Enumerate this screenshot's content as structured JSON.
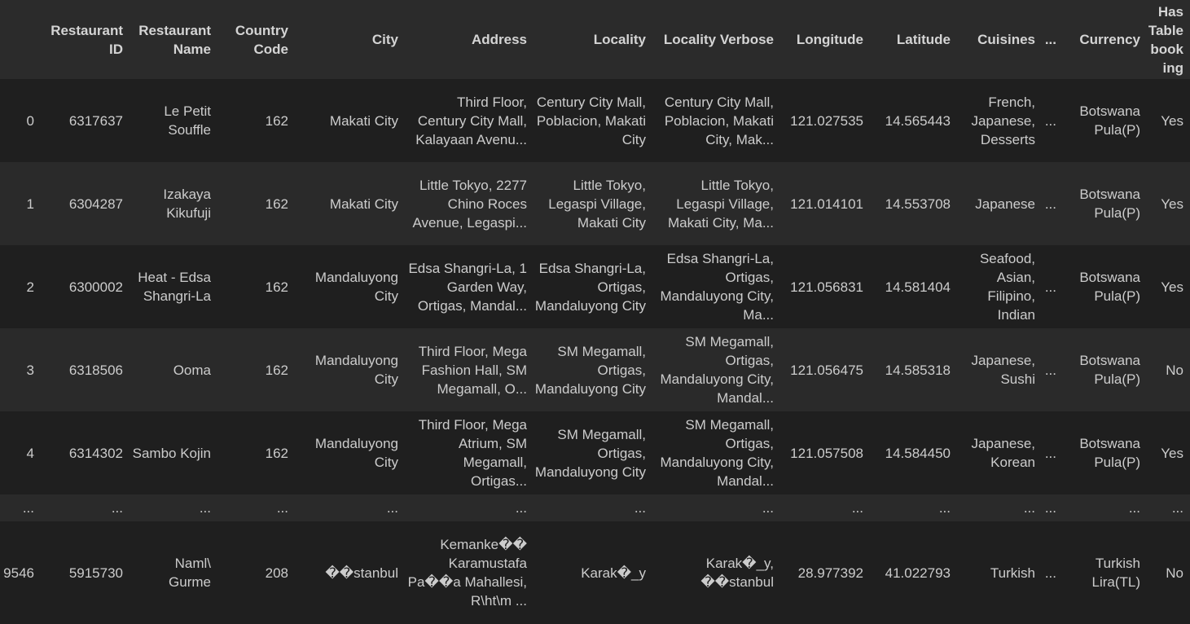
{
  "table": {
    "columns": [
      {
        "key": "index",
        "label": ""
      },
      {
        "key": "restaurant_id",
        "label": "Restaurant ID"
      },
      {
        "key": "restaurant_name",
        "label": "Restaurant Name"
      },
      {
        "key": "country_code",
        "label": "Country Code"
      },
      {
        "key": "city",
        "label": "City"
      },
      {
        "key": "address",
        "label": "Address"
      },
      {
        "key": "locality",
        "label": "Locality"
      },
      {
        "key": "locality_verbose",
        "label": "Locality Verbose"
      },
      {
        "key": "longitude",
        "label": "Longitude"
      },
      {
        "key": "latitude",
        "label": "Latitude"
      },
      {
        "key": "cuisines",
        "label": "Cuisines"
      },
      {
        "key": "ellipsis",
        "label": "..."
      },
      {
        "key": "currency",
        "label": "Currency"
      },
      {
        "key": "has_table_booking",
        "label": "Has Table booking"
      }
    ],
    "rows": [
      [
        "0",
        "6317637",
        "Le Petit Souffle",
        "162",
        "Makati City",
        "Third Floor, Century City Mall, Kalayaan Avenu...",
        "Century City Mall, Poblacion, Makati City",
        "Century City Mall, Poblacion, Makati City, Mak...",
        "121.027535",
        "14.565443",
        "French, Japanese, Desserts",
        "...",
        "Botswana Pula(P)",
        "Yes"
      ],
      [
        "1",
        "6304287",
        "Izakaya Kikufuji",
        "162",
        "Makati City",
        "Little Tokyo, 2277 Chino Roces Avenue, Legaspi...",
        "Little Tokyo, Legaspi Village, Makati City",
        "Little Tokyo, Legaspi Village, Makati City, Ma...",
        "121.014101",
        "14.553708",
        "Japanese",
        "...",
        "Botswana Pula(P)",
        "Yes"
      ],
      [
        "2",
        "6300002",
        "Heat - Edsa Shangri-La",
        "162",
        "Mandaluyong City",
        "Edsa Shangri-La, 1 Garden Way, Ortigas, Mandal...",
        "Edsa Shangri-La, Ortigas, Mandaluyong City",
        "Edsa Shangri-La, Ortigas, Mandaluyong City, Ma...",
        "121.056831",
        "14.581404",
        "Seafood, Asian, Filipino, Indian",
        "...",
        "Botswana Pula(P)",
        "Yes"
      ],
      [
        "3",
        "6318506",
        "Ooma",
        "162",
        "Mandaluyong City",
        "Third Floor, Mega Fashion Hall, SM Megamall, O...",
        "SM Megamall, Ortigas, Mandaluyong City",
        "SM Megamall, Ortigas, Mandaluyong City, Mandal...",
        "121.056475",
        "14.585318",
        "Japanese, Sushi",
        "...",
        "Botswana Pula(P)",
        "No"
      ],
      [
        "4",
        "6314302",
        "Sambo Kojin",
        "162",
        "Mandaluyong City",
        "Third Floor, Mega Atrium, SM Megamall, Ortigas...",
        "SM Megamall, Ortigas, Mandaluyong City",
        "SM Megamall, Ortigas, Mandaluyong City, Mandal...",
        "121.057508",
        "14.584450",
        "Japanese, Korean",
        "...",
        "Botswana Pula(P)",
        "Yes"
      ],
      [
        "...",
        "...",
        "...",
        "...",
        "...",
        "...",
        "...",
        "...",
        "...",
        "...",
        "...",
        "...",
        "...",
        "..."
      ],
      [
        "9546",
        "5915730",
        "Naml\\ Gurme",
        "208",
        "��stanbul",
        "Kemanke�� Karamustafa Pa��a Mahallesi, R\\ht\\m ...",
        "Karak�_y",
        "Karak�_y, ��stanbul",
        "28.977392",
        "41.022793",
        "Turkish",
        "...",
        "Turkish Lira(TL)",
        "No"
      ]
    ]
  }
}
